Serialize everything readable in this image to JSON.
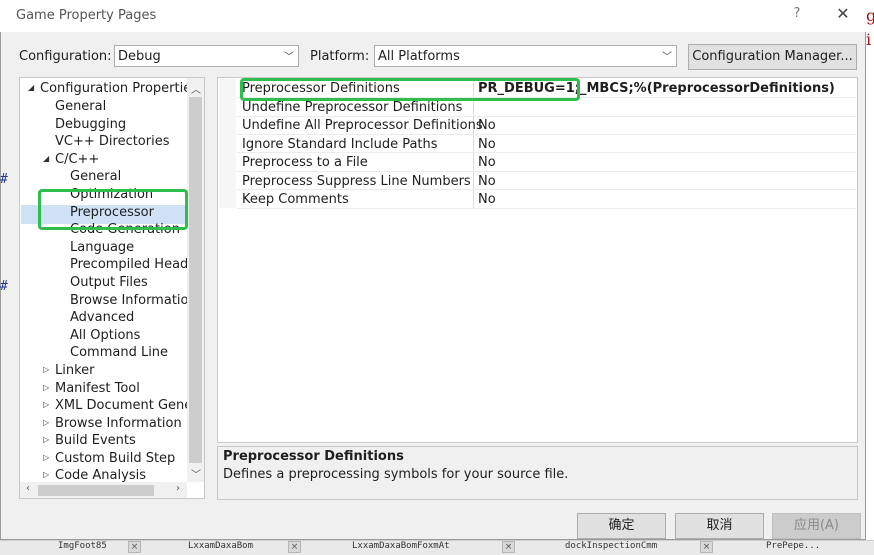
{
  "dialog": {
    "title": "Game Property Pages",
    "help": "?",
    "close": "✕"
  },
  "toolbar": {
    "configuration_label": "Configuration:",
    "configuration_value": "Debug",
    "platform_label": "Platform:",
    "platform_value": "All Platforms",
    "config_manager": "Configuration Manager..."
  },
  "tree": {
    "root": "Configuration Properties",
    "items": [
      "General",
      "Debugging",
      "VC++ Directories",
      "C/C++",
      "General",
      "Optimization",
      "Preprocessor",
      "Code Generation",
      "Language",
      "Precompiled Heade",
      "Output Files",
      "Browse Information",
      "Advanced",
      "All Options",
      "Command Line",
      "Linker",
      "Manifest Tool",
      "XML Document Genera",
      "Browse Information",
      "Build Events",
      "Custom Build Step",
      "Code Analysis"
    ]
  },
  "grid": {
    "rows": [
      {
        "name": "Preprocessor Definitions",
        "value": "PR_DEBUG=1;_MBCS;%(PreprocessorDefinitions)"
      },
      {
        "name": "Undefine Preprocessor Definitions",
        "value": ""
      },
      {
        "name": "Undefine All Preprocessor Definitions",
        "value": "No"
      },
      {
        "name": "Ignore Standard Include Paths",
        "value": "No"
      },
      {
        "name": "Preprocess to a File",
        "value": "No"
      },
      {
        "name": "Preprocess Suppress Line Numbers",
        "value": "No"
      },
      {
        "name": "Keep Comments",
        "value": "No"
      }
    ]
  },
  "description": {
    "title": "Preprocessor Definitions",
    "text": "Defines a preprocessing symbols for your source file."
  },
  "buttons": {
    "ok": "确定",
    "cancel": "取消",
    "apply": "应用(A)"
  },
  "background": {
    "right_chars": [
      "g",
      "i"
    ],
    "hash": [
      "#",
      "#"
    ],
    "tabs": [
      "ImgFoot85",
      "LxxamDaxaBom",
      "LxxamDaxaBomFoxmAt",
      "dockInspectionCmm",
      "PrePepe..."
    ]
  },
  "colors": {
    "highlight": "#2fbd4e",
    "selection": "#cfe1f5"
  }
}
